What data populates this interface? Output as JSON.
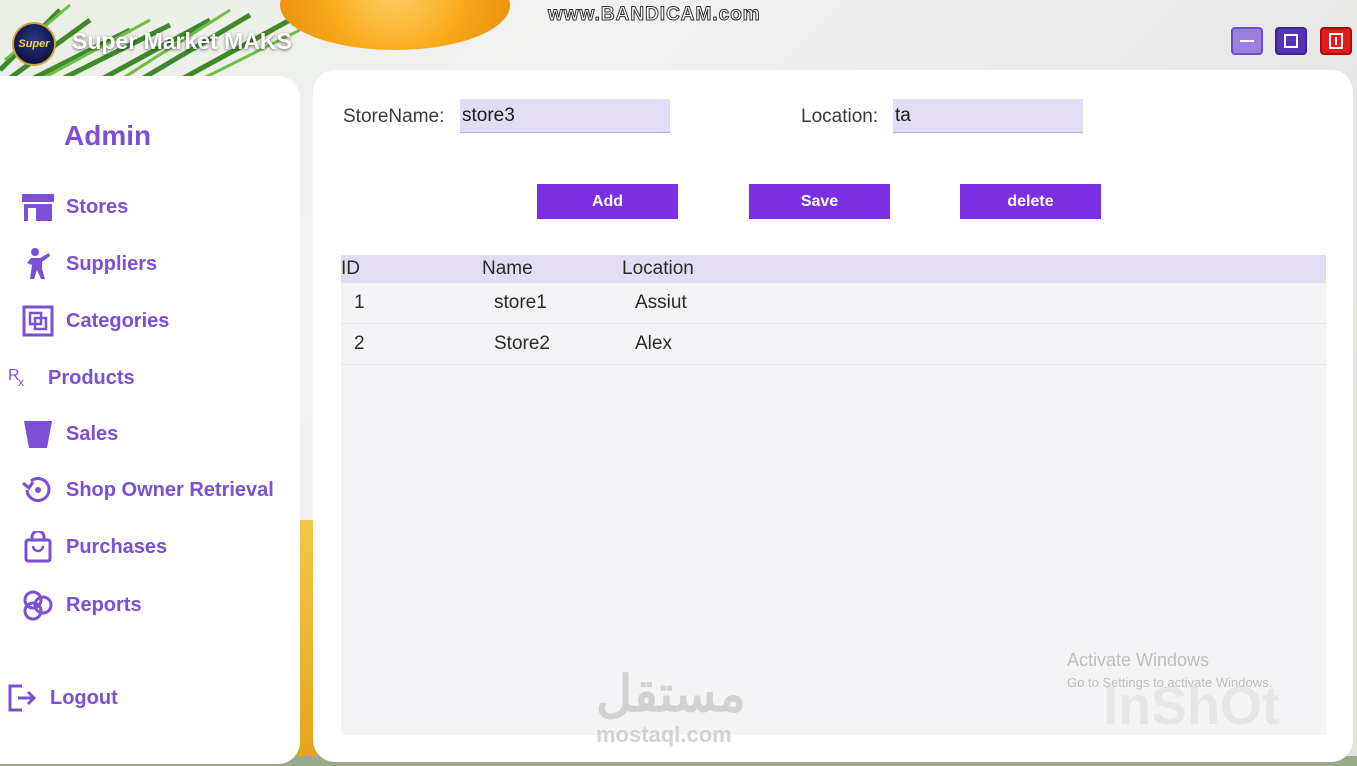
{
  "window": {
    "title": "Super Market MAKS",
    "logo_text": "Super",
    "recorder_watermark": "www.BANDICAM.com"
  },
  "sidebar": {
    "role_title": "Admin",
    "items": [
      {
        "label": "Stores",
        "icon": "store-icon"
      },
      {
        "label": "Suppliers",
        "icon": "person-icon"
      },
      {
        "label": "Categories",
        "icon": "categories-icon"
      },
      {
        "label": "Products",
        "icon": "rx-icon"
      },
      {
        "label": "Sales",
        "icon": "bucket-icon"
      },
      {
        "label": "Shop Owner Retrieval",
        "icon": "retrieval-icon"
      },
      {
        "label": "Purchases",
        "icon": "shopping-bag-icon"
      },
      {
        "label": "Reports",
        "icon": "reports-icon"
      }
    ],
    "logout_label": "Logout"
  },
  "form": {
    "store_name_label": "StoreName:",
    "store_name_value": "store3",
    "location_label": "Location:",
    "location_value": "ta"
  },
  "buttons": {
    "add": "Add",
    "save": "Save",
    "delete": "delete"
  },
  "table": {
    "columns": [
      "ID",
      "Name",
      "Location"
    ],
    "rows": [
      {
        "id": "1",
        "name": "store1",
        "location": "Assiut"
      },
      {
        "id": "2",
        "name": "Store2",
        "location": "Alex"
      }
    ]
  },
  "overlays": {
    "activate_title": "Activate Windows",
    "activate_sub": "Go to Settings to activate Windows.",
    "inshot": "InShOt",
    "mostaql_ar": "مستقل",
    "mostaql_en": "mostaql.com"
  },
  "colors": {
    "accent": "#7b2fe3",
    "nav_text": "#7b4fd6",
    "input_bg": "#e2ddf2",
    "close": "#e31b1b"
  }
}
